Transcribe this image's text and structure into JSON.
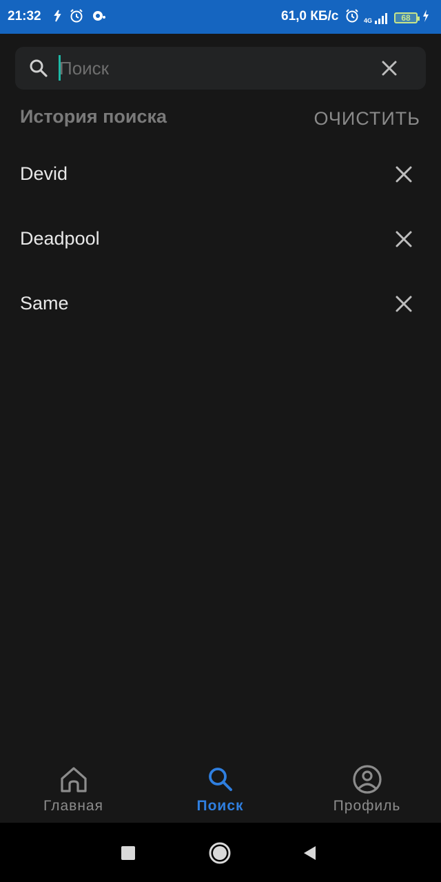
{
  "status_bar": {
    "time": "21:32",
    "network_speed": "61,0 КБ/с",
    "network_type": "4G",
    "battery_level": "68",
    "left_icons": [
      "sync-icon",
      "alarm-icon",
      "notification-icon"
    ],
    "right_icons": [
      "alarm-icon",
      "signal-icon",
      "battery-icon",
      "charging-icon"
    ],
    "background_color": "#1565c0"
  },
  "search": {
    "placeholder": "Поиск",
    "value": "",
    "cursor_color": "#1db9a6"
  },
  "history": {
    "title": "История поиска",
    "clear_label": "ОЧИСТИТЬ",
    "items": [
      {
        "label": "Devid"
      },
      {
        "label": "Deadpool"
      },
      {
        "label": "Same"
      }
    ]
  },
  "bottom_nav": {
    "items": [
      {
        "label": "Главная",
        "icon": "home-icon",
        "active": false
      },
      {
        "label": "Поиск",
        "icon": "search-icon",
        "active": true
      },
      {
        "label": "Профиль",
        "icon": "profile-icon",
        "active": false
      }
    ],
    "active_color": "#2f7fe0"
  },
  "system_nav": {
    "buttons": [
      "recents-button",
      "home-button",
      "back-button"
    ]
  }
}
